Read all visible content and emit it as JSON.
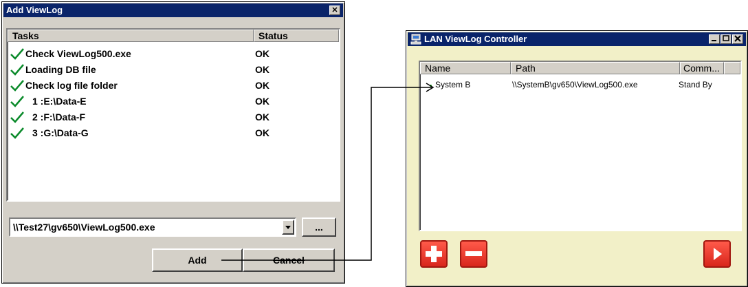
{
  "add_dialog": {
    "title": "Add ViewLog",
    "close_glyph": "✕",
    "columns": {
      "tasks": "Tasks",
      "status": "Status"
    },
    "rows": [
      {
        "task": "Check ViewLog500.exe",
        "status": "OK"
      },
      {
        "task": "Loading DB file",
        "status": "OK"
      },
      {
        "task": "Check log file folder",
        "status": "OK"
      },
      {
        "task": "1 :E:\\Data-E",
        "status": "OK"
      },
      {
        "task": "2 :F:\\Data-F",
        "status": "OK"
      },
      {
        "task": "3 :G:\\Data-G",
        "status": "OK"
      }
    ],
    "path_value": "\\\\Test27\\gv650\\ViewLog500.exe",
    "browse_label": "...",
    "add_label": "Add",
    "cancel_label": "Cancel"
  },
  "controller": {
    "title": "LAN ViewLog Controller",
    "columns": {
      "name": "Name",
      "path": "Path",
      "comm": "Comm..."
    },
    "rows": [
      {
        "name": "System B",
        "path": "\\\\SystemB\\gv650\\ViewLog500.exe",
        "comm": "Stand By"
      }
    ]
  },
  "colors": {
    "titlebar": "#0a246a",
    "face": "#d4d0c8",
    "check": "#0a8a2a",
    "red_button": "#e8362a"
  }
}
